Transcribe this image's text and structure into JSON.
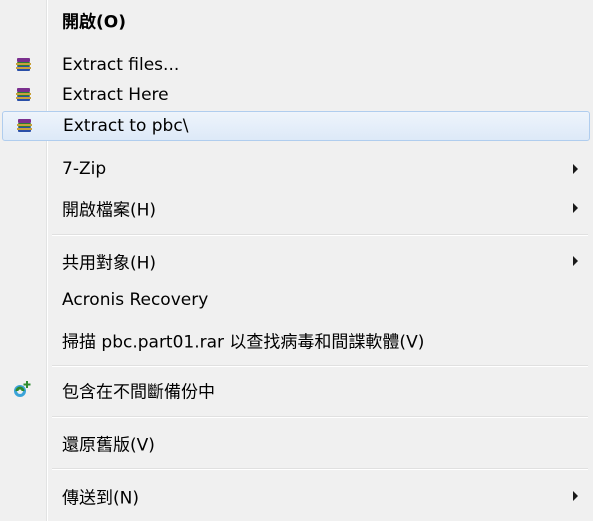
{
  "menu": {
    "items": [
      {
        "label": "開啟(O)",
        "bold": true
      },
      {
        "label": "Extract files...",
        "icon": "winrar-icon"
      },
      {
        "label": "Extract Here",
        "icon": "winrar-icon"
      },
      {
        "label": "Extract to pbc\\",
        "icon": "winrar-icon",
        "highlighted": true
      },
      {
        "label": "7-Zip",
        "submenu": true
      },
      {
        "label": "開啟檔案(H)",
        "submenu": true
      },
      {
        "label": "共用對象(H)",
        "submenu": true
      },
      {
        "label": "Acronis Recovery"
      },
      {
        "label": "掃描 pbc.part01.rar 以查找病毒和間諜軟體(V)"
      },
      {
        "label": "包含在不間斷備份中",
        "icon": "continuous-backup-icon"
      },
      {
        "label": "還原舊版(V)"
      },
      {
        "label": "傳送到(N)",
        "submenu": true
      }
    ]
  },
  "colors": {
    "menu_background": "#f0f0f0",
    "highlight_border": "#b0cdee",
    "highlight_fill": "#dde9f8"
  }
}
